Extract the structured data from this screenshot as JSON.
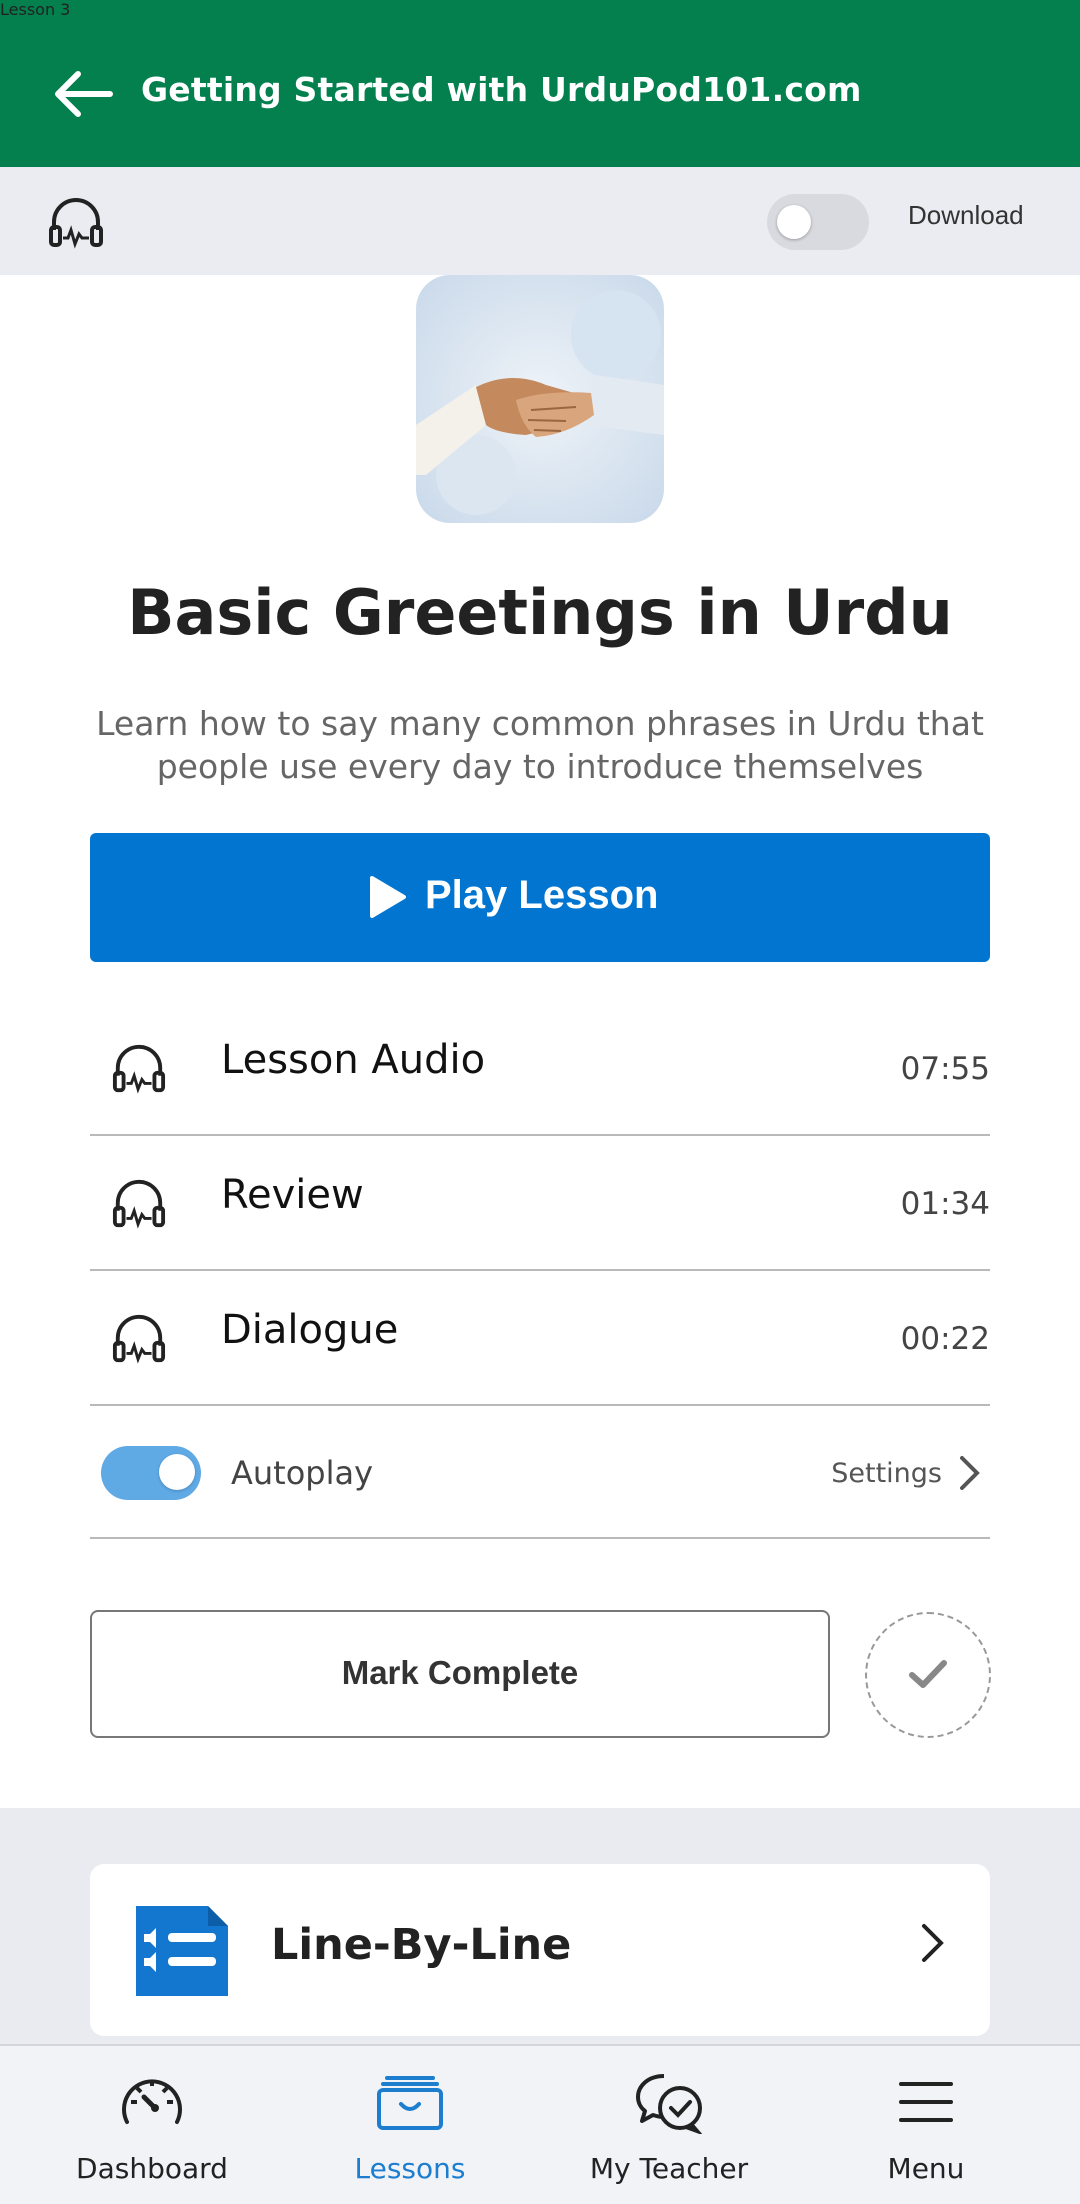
{
  "header": {
    "title": "Getting Started with UrduPod101.com"
  },
  "subbar": {
    "lesson_number": "Lesson 3",
    "download_label": "Download",
    "download_on": false
  },
  "lesson": {
    "title": "Basic Greetings in Urdu",
    "description": "Learn how to say many common phrases in Urdu that people use every day to introduce themselves",
    "play_label": "Play Lesson",
    "tracks": [
      {
        "name": "Lesson Audio",
        "duration": "07:55"
      },
      {
        "name": "Review",
        "duration": "01:34"
      },
      {
        "name": "Dialogue",
        "duration": "00:22"
      }
    ],
    "autoplay_label": "Autoplay",
    "autoplay_on": true,
    "settings_label": "Settings",
    "mark_complete_label": "Mark Complete"
  },
  "resources": [
    {
      "label": "Line-By-Line"
    }
  ],
  "bottom_nav": [
    {
      "label": "Dashboard",
      "icon": "speedometer-icon",
      "active": false
    },
    {
      "label": "Lessons",
      "icon": "lessons-box-icon",
      "active": true
    },
    {
      "label": "My Teacher",
      "icon": "chat-bubbles-icon",
      "active": false
    },
    {
      "label": "Menu",
      "icon": "hamburger-menu-icon",
      "active": false
    }
  ],
  "colors": {
    "brand_green": "#047f4e",
    "play_blue": "#0175d0",
    "active_blue": "#1d7ecf",
    "toggle_blue": "#5fa9e5"
  }
}
